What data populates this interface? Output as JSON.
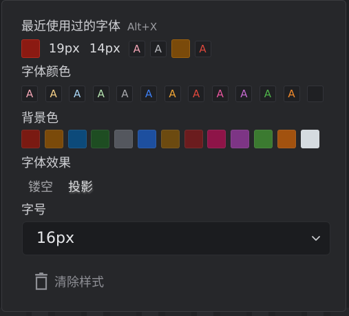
{
  "recent": {
    "title": "最近使用过的字体",
    "shortcut": "Alt+X",
    "swatch_dark_red": "#8b1a12",
    "size_a": "19px",
    "size_b": "14px",
    "glyph_letter": "A",
    "glyph_pink_color": "#f4a6b6",
    "glyph_gray_color": "#b8b9be",
    "swatch_brown": "#7a4a0a",
    "glyph_red_color": "#e0483c"
  },
  "font_color": {
    "title": "字体颜色",
    "letter": "A",
    "colors": [
      "#f4a6b6",
      "#f6d189",
      "#a9d6f5",
      "#b5e3b0",
      "#a8a9ad",
      "#3d7ff5",
      "#f0a535",
      "#e0483c",
      "#e8559e",
      "#c56ad0",
      "#4fb54a",
      "#f28a2c",
      "#1f2023"
    ]
  },
  "background": {
    "title": "背景色",
    "colors": [
      "#7a1a12",
      "#7a4a0a",
      "#0c4a7a",
      "#1e4d22",
      "#54575e",
      "#1d4f9f",
      "#6c4a10",
      "#6b1c1e",
      "#8e1448",
      "#7d3585",
      "#3b7a30",
      "#a2520f",
      "#d5dbe0"
    ]
  },
  "effects": {
    "title": "字体效果",
    "hollow": "镂空",
    "shadow": "投影"
  },
  "size": {
    "title": "字号",
    "value": "16px"
  },
  "clear": {
    "label": "清除样式"
  }
}
